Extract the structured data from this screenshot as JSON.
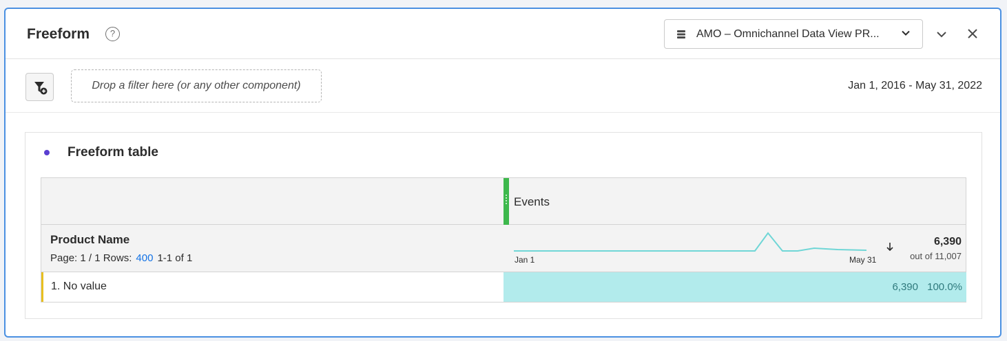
{
  "panel": {
    "title": "Freeform",
    "help_glyph": "?",
    "dataview_label": "AMO – Omnichannel Data View PR...",
    "icons": [
      "help-icon",
      "database-icon",
      "chevron-down-icon",
      "collapse-icon",
      "close-icon"
    ],
    "border_color": "#4a90e2"
  },
  "filterbar": {
    "dropzone_text": "Drop a filter here (or any other component)",
    "date_range": "Jan 1, 2016 - May 31, 2022"
  },
  "table": {
    "title": "Freeform table",
    "dot_color": "#5a3fd1",
    "metric_header": "Events",
    "dimension": "Product Name",
    "pager": {
      "page_text": "Page: 1 / 1 Rows:",
      "rows_value": "400",
      "range_text": "1-1 of 1"
    },
    "sparkline": {
      "start_label": "Jan 1",
      "end_label": "May 31",
      "color": "#6fd6d6"
    },
    "total": {
      "value": "6,390",
      "out_of": "out of 11,007"
    },
    "rows": [
      {
        "label": "1.  No value",
        "value": "6,390",
        "percent": "100.0%",
        "fill": 1.0
      }
    ]
  }
}
